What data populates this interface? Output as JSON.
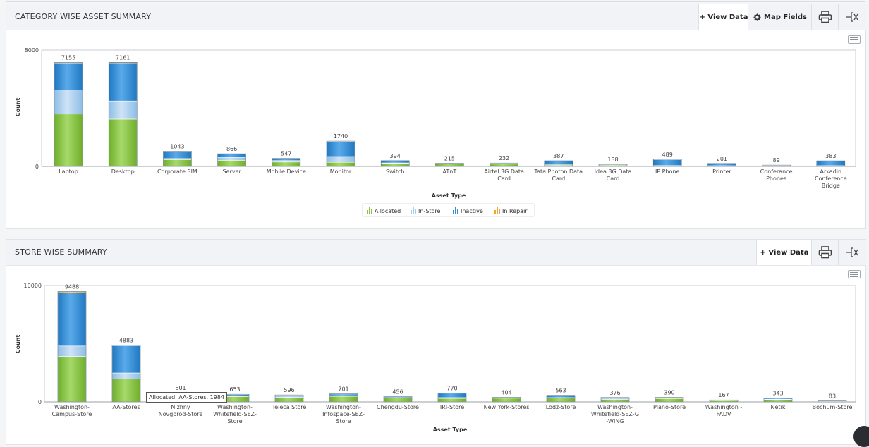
{
  "colors": {
    "allocated": "#8cc63f",
    "in_store": "#a9cdee",
    "inactive": "#3a8fd4",
    "in_repair": "#f0a630"
  },
  "category_panel": {
    "title": "CATEGORY WISE ASSET SUMMARY",
    "view_data_label": "+ View Data",
    "map_fields_label": "Map Fields",
    "icons": [
      "gear-icon",
      "printer-icon",
      "export-icon",
      "chart-menu-icon"
    ]
  },
  "store_panel": {
    "title": "STORE WISE SUMMARY",
    "view_data_label": "+ View Data",
    "icons": [
      "printer-icon",
      "export-icon",
      "chart-menu-icon"
    ]
  },
  "tooltip": {
    "text": "Allocated, AA-Stores, 1984"
  },
  "chart_data": [
    {
      "type": "bar",
      "stacked": true,
      "xlabel": "Asset Type",
      "ylabel": "Count",
      "ylim": [
        0,
        8000
      ],
      "yticks": [
        "0",
        "8000"
      ],
      "legend_position": "bottom-center",
      "legend": [
        "Allocated",
        "In-Store",
        "Inactive",
        "In Repair"
      ],
      "categories": [
        [
          "Laptop"
        ],
        [
          "Desktop"
        ],
        [
          "Corporate SIM"
        ],
        [
          "Server"
        ],
        [
          "Mobile Device"
        ],
        [
          "Monitor"
        ],
        [
          "Switch"
        ],
        [
          "ATnT"
        ],
        [
          "Airtel 3G Data",
          "Card"
        ],
        [
          "Tata Photon Data",
          "Card"
        ],
        [
          "Idea 3G Data",
          "Card"
        ],
        [
          "IP Phone"
        ],
        [
          "Printer"
        ],
        [
          "Conferance",
          "Phones"
        ],
        [
          "Arkadin",
          "Conference",
          "Bridge"
        ]
      ],
      "totals": [
        "7155",
        "7161",
        "1043",
        "866",
        "547",
        "1740",
        "394",
        "215",
        "232",
        "387",
        "138",
        "489",
        "201",
        "89",
        "383"
      ],
      "series": [
        {
          "name": "Allocated",
          "values": [
            3600,
            3250,
            470,
            420,
            300,
            280,
            210,
            170,
            160,
            90,
            100,
            40,
            40,
            60,
            40
          ]
        },
        {
          "name": "In-Store",
          "values": [
            1650,
            1250,
            70,
            200,
            100,
            400,
            30,
            15,
            20,
            20,
            8,
            20,
            10,
            9,
            13
          ]
        },
        {
          "name": "Inactive",
          "values": [
            1825,
            2581,
            483,
            226,
            127,
            1040,
            134,
            10,
            32,
            257,
            10,
            409,
            131,
            10,
            310
          ]
        },
        {
          "name": "In Repair",
          "values": [
            80,
            80,
            20,
            20,
            20,
            20,
            20,
            20,
            20,
            20,
            20,
            20,
            20,
            10,
            20
          ]
        }
      ]
    },
    {
      "type": "bar",
      "stacked": true,
      "xlabel": "Asset Type",
      "ylabel": "Count",
      "ylim": [
        0,
        10000
      ],
      "yticks": [
        "0",
        "10000"
      ],
      "categories": [
        [
          "Washington-",
          "Campus-Store"
        ],
        [
          "AA-Stores"
        ],
        [
          "Nizhny",
          "Novgorod-Store"
        ],
        [
          "Washington-",
          "Whitefield-SEZ-",
          "Store"
        ],
        [
          "Teleca Store"
        ],
        [
          "Washington-",
          "Infospace-SEZ-",
          "Store"
        ],
        [
          "Chengdu-Store"
        ],
        [
          "IRI-Store"
        ],
        [
          "New York-Stores"
        ],
        [
          "Lodz-Store"
        ],
        [
          "Washington-",
          "Whitefield-SEZ-G",
          "-WING"
        ],
        [
          "Plano-Store"
        ],
        [
          "Washington -",
          "FADV"
        ],
        [
          "Netik"
        ],
        [
          "Bochum-Store"
        ]
      ],
      "totals": [
        "9488",
        "4883",
        "801",
        "653",
        "596",
        "701",
        "456",
        "770",
        "404",
        "563",
        "376",
        "390",
        "167",
        "343",
        "83"
      ],
      "series": [
        {
          "name": "Allocated",
          "values": [
            3900,
            1984,
            500,
            460,
            380,
            480,
            320,
            300,
            320,
            320,
            220,
            290,
            130,
            200,
            60
          ]
        },
        {
          "name": "In-Store",
          "values": [
            900,
            500,
            80,
            50,
            60,
            60,
            30,
            70,
            20,
            50,
            40,
            20,
            10,
            30,
            10
          ]
        },
        {
          "name": "Inactive",
          "values": [
            4588,
            2349,
            201,
            123,
            136,
            141,
            86,
            380,
            44,
            173,
            96,
            60,
            17,
            93,
            3
          ]
        },
        {
          "name": "In Repair",
          "values": [
            100,
            50,
            20,
            20,
            20,
            20,
            20,
            20,
            20,
            20,
            20,
            20,
            10,
            20,
            10
          ]
        }
      ]
    }
  ]
}
